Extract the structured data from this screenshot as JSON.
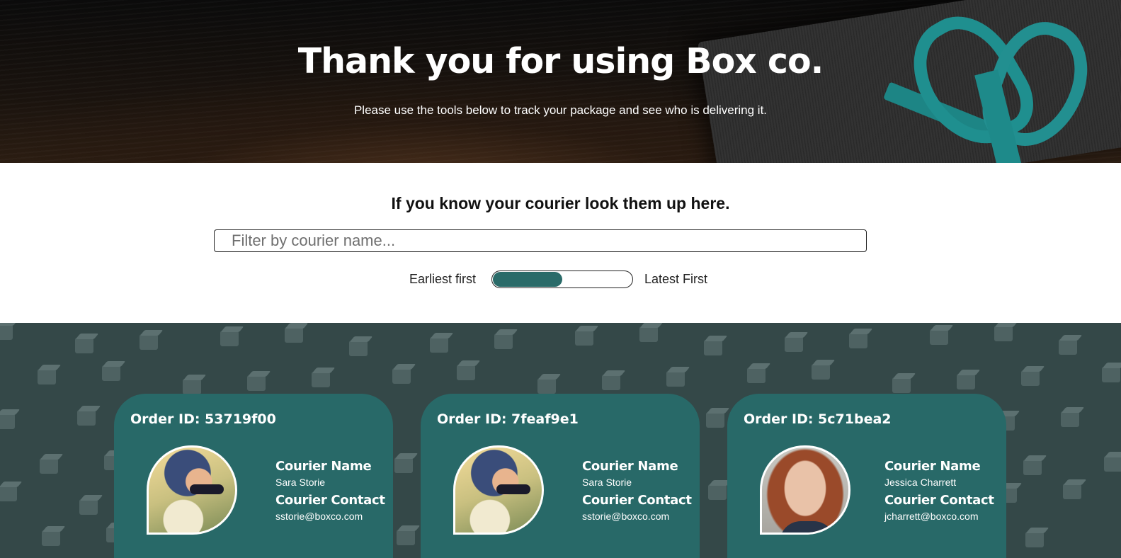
{
  "hero": {
    "title": "Thank you for using Box co.",
    "subtitle": "Please use the tools below to track your package and see who is delivering it."
  },
  "filter": {
    "heading": "If you know your courier look them up here.",
    "placeholder": "Filter by courier name...",
    "value": "",
    "sort_left_label": "Earliest first",
    "sort_right_label": "Latest First",
    "sort_toggle_level": 0.5
  },
  "cards": [
    {
      "order_label": "Order ID: 53719f00",
      "avatar": "courier-photo-sara",
      "name_label": "Courier Name",
      "name": "Sara Storie",
      "contact_label": "Courier Contact",
      "contact": "sstorie@boxco.com"
    },
    {
      "order_label": "Order ID: 7feaf9e1",
      "avatar": "courier-photo-sara",
      "name_label": "Courier Name",
      "name": "Sara Storie",
      "contact_label": "Courier Contact",
      "contact": "sstorie@boxco.com"
    },
    {
      "order_label": "Order ID: 5c71bea2",
      "avatar": "courier-photo-jessica",
      "name_label": "Courier Name",
      "name": "Jessica Charrett",
      "contact_label": "Courier Contact",
      "contact": "jcharrett@boxco.com"
    }
  ],
  "colors": {
    "accent_teal": "#286968",
    "cards_background": "#344848",
    "toggle_fill": "#2a6b69"
  }
}
